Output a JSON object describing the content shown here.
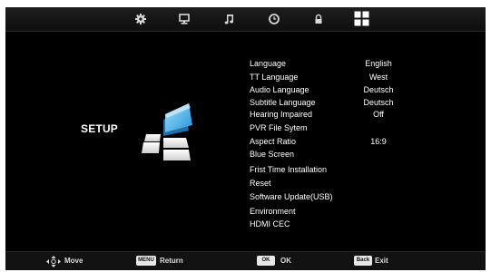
{
  "top_icons": [
    "gear-icon",
    "monitor-icon",
    "music-note-icon",
    "clock-icon",
    "lock-icon",
    "grid-icon"
  ],
  "setup_title": "SETUP",
  "menu": [
    {
      "label": "Language",
      "value": "English"
    },
    {
      "label": "TT Language",
      "value": "West"
    },
    {
      "label": "Audio Language",
      "value": "Deutsch"
    },
    {
      "label": "Subtitle Language",
      "value": "Deutsch"
    },
    {
      "label": "Hearing Impaired",
      "value": "Off"
    },
    {
      "label": "PVR File Sytem",
      "value": ""
    },
    {
      "label": "Aspect Ratio",
      "value": "16:9"
    },
    {
      "label": "Blue Screen",
      "value": ""
    },
    {
      "label": "Frist Time Installation",
      "value": ""
    },
    {
      "label": "Reset",
      "value": ""
    },
    {
      "label": "Software Update(USB)",
      "value": ""
    },
    {
      "label": "Environment",
      "value": ""
    },
    {
      "label": "HDMI CEC",
      "value": ""
    }
  ],
  "bottom": {
    "move_label": "Move",
    "menu_key": "MENU",
    "return_label": "Return",
    "ok_key": "OK",
    "ok_label": "OK",
    "back_key": "Back",
    "exit_label": "Exit"
  },
  "colors": {
    "active_tab": "#ffffff",
    "tile_blue": "#59b6ea",
    "background": "#000000"
  }
}
